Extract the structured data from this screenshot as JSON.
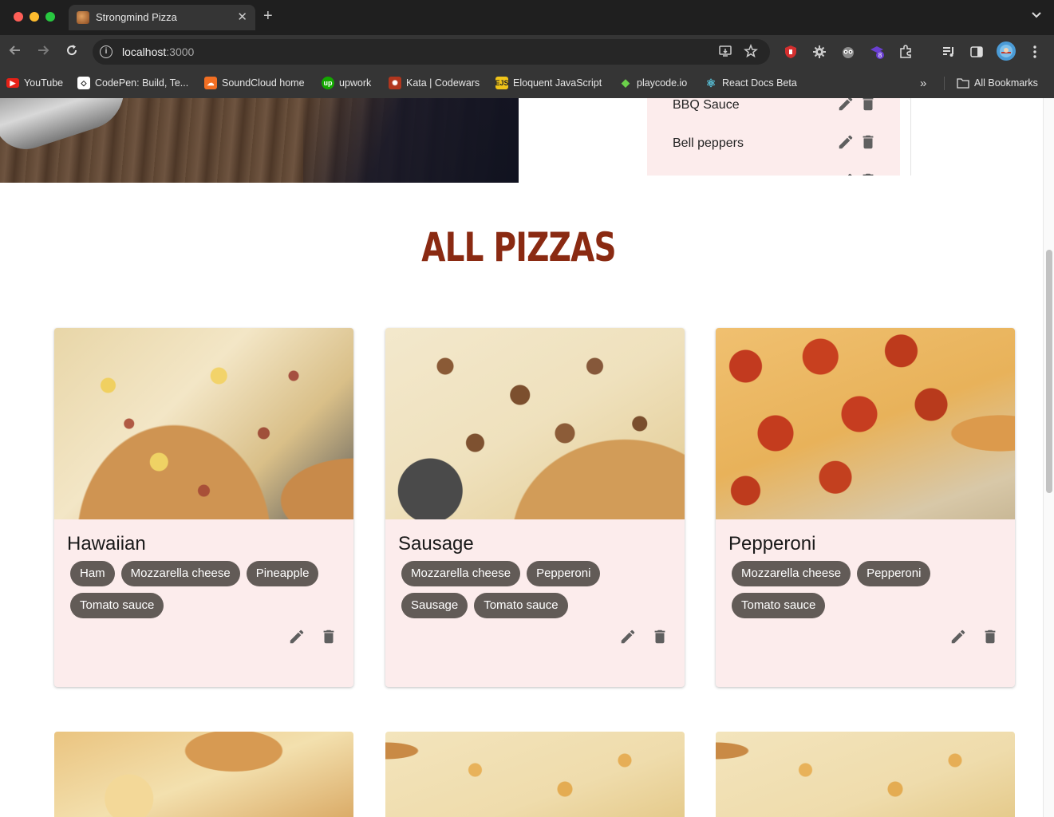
{
  "browser": {
    "tab_title": "Strongmind Pizza",
    "url_host": "localhost",
    "url_port": ":3000",
    "extension_badge": "8",
    "bookmarks": [
      {
        "label": "YouTube",
        "icon": "youtube-icon",
        "color": "#e62117"
      },
      {
        "label": "CodePen: Build, Te...",
        "icon": "codepen-icon",
        "color": "#ffffff"
      },
      {
        "label": "SoundCloud home",
        "icon": "soundcloud-icon",
        "color": "#f26f23"
      },
      {
        "label": "upwork",
        "icon": "upwork-icon",
        "color": "#14a800"
      },
      {
        "label": "Kata | Codewars",
        "icon": "codewars-icon",
        "color": "#b1361e"
      },
      {
        "label": "Eloquent JavaScript",
        "icon": "ejs-icon",
        "color": "#f0c419"
      },
      {
        "label": "playcode.io",
        "icon": "playcode-icon",
        "color": "#6bd04a"
      },
      {
        "label": "React Docs Beta",
        "icon": "react-icon",
        "color": "#58c4dc"
      }
    ],
    "all_bookmarks": "All Bookmarks"
  },
  "toppings": {
    "items": [
      "BBQ Sauce",
      "Bell peppers"
    ]
  },
  "section": {
    "title": "ALL PIZZAS"
  },
  "pizzas": [
    {
      "name": "Hawaiian",
      "toppings": [
        "Ham",
        "Mozzarella cheese",
        "Pineapple",
        "Tomato sauce"
      ]
    },
    {
      "name": "Sausage",
      "toppings": [
        "Mozzarella cheese",
        "Pepperoni",
        "Sausage",
        "Tomato sauce"
      ]
    },
    {
      "name": "Pepperoni",
      "toppings": [
        "Mozzarella cheese",
        "Pepperoni",
        "Tomato sauce"
      ]
    }
  ],
  "colors": {
    "accent_title": "#8a2a12",
    "card_bg": "#fcecec",
    "chip_bg": "#625b57"
  }
}
